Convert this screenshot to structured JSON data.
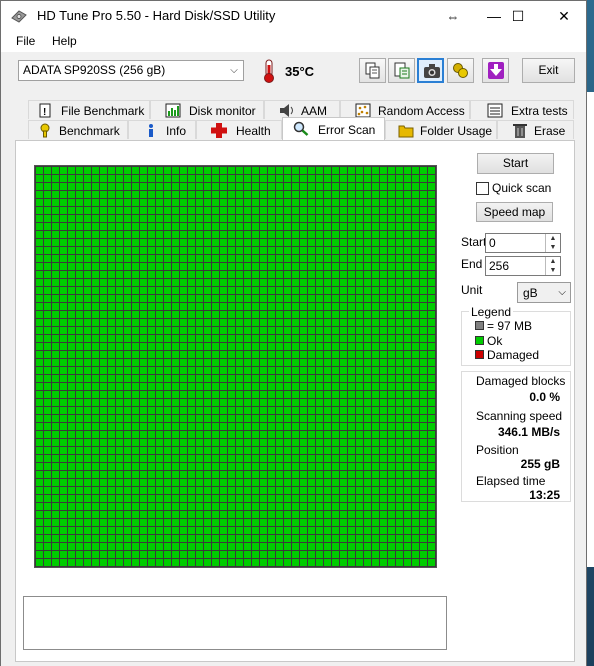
{
  "window": {
    "title": "HD Tune Pro 5.50 - Hard Disk/SSD Utility",
    "controls": {
      "resize": "⇔",
      "minimize": "—",
      "maximize": "☐",
      "close": "✕"
    }
  },
  "menu": {
    "file": "File",
    "help": "Help"
  },
  "toolbar": {
    "drive": "ADATA SP920SS (256 gB)",
    "temperature": "35",
    "temperature_unit": "°C",
    "exit_label": "Exit"
  },
  "tabs": {
    "top_row": [
      "File Benchmark",
      "Disk monitor",
      "AAM",
      "Random Access",
      "Extra tests"
    ],
    "bottom_row": [
      "Benchmark",
      "Info",
      "Health",
      "Error Scan",
      "Folder Usage",
      "Erase"
    ],
    "selected": "Error Scan"
  },
  "scan_controls": {
    "start_label": "Start",
    "quick_scan_label": "Quick scan",
    "quick_scan_checked": false,
    "speed_map_label": "Speed map",
    "start_field_label": "Start",
    "start_value": "0",
    "end_field_label": "End",
    "end_value": "256",
    "unit_label": "Unit",
    "unit_value": "gB"
  },
  "legend": {
    "title": "Legend",
    "block_size": "= 97 MB",
    "ok": "Ok",
    "damaged": "Damaged"
  },
  "stats": {
    "damaged_blocks_label": "Damaged blocks",
    "damaged_blocks_value": "0.0 %",
    "scanning_speed_label": "Scanning speed",
    "scanning_speed_value": "346.1 MB/s",
    "position_label": "Position",
    "position_value": "255 gB",
    "elapsed_label": "Elapsed time",
    "elapsed_value": "13:25"
  },
  "grid": {
    "status": "all blocks ok",
    "ok_color": "#00cc00",
    "damaged_color": "#cc0000",
    "unscanned_color": "#808080"
  }
}
